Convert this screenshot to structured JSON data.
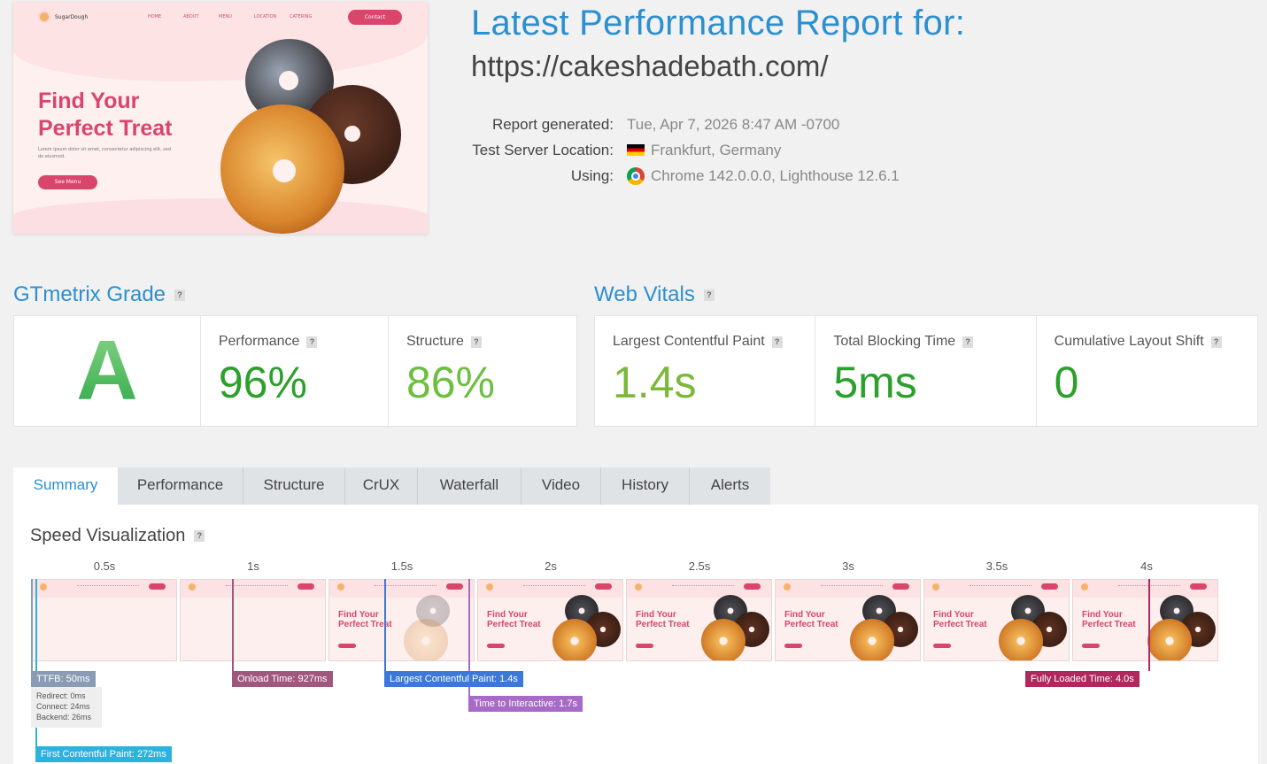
{
  "thumbnail": {
    "logo_text": "SugarDough",
    "nav": [
      "HOME",
      "ABOUT",
      "MENU",
      "LOCATION",
      "CATERING"
    ],
    "contact_label": "Contact",
    "hero_line1": "Find Your",
    "hero_line2": "Perfect Treat",
    "lorem": "Lorem ipsum dolor sit amet, consectetur adipiscing elit, sed do eiusmod.",
    "cta_label": "See Menu"
  },
  "header": {
    "title": "Latest Performance Report for:",
    "url": "https://cakeshadebath.com/"
  },
  "meta": {
    "generated_label": "Report generated:",
    "generated_value": "Tue, Apr 7, 2026 8:47 AM -0700",
    "location_label": "Test Server Location:",
    "location_value": "Frankfurt, Germany",
    "using_label": "Using:",
    "using_value": "Chrome 142.0.0.0, Lighthouse 12.6.1"
  },
  "gtmetrix": {
    "title": "GTmetrix Grade",
    "grade": "A",
    "performance_label": "Performance",
    "performance_value": "96%",
    "structure_label": "Structure",
    "structure_value": "86%"
  },
  "web_vitals": {
    "title": "Web Vitals",
    "lcp_label": "Largest Contentful Paint",
    "lcp_value": "1.4s",
    "tbt_label": "Total Blocking Time",
    "tbt_value": "5ms",
    "cls_label": "Cumulative Layout Shift",
    "cls_value": "0"
  },
  "tabs": [
    "Summary",
    "Performance",
    "Structure",
    "CrUX",
    "Waterfall",
    "Video",
    "History",
    "Alerts"
  ],
  "active_tab": "Summary",
  "speed_viz": {
    "title": "Speed Visualization",
    "ticks": [
      "0.5s",
      "1s",
      "1.5s",
      "2s",
      "2.5s",
      "3s",
      "3.5s",
      "4s"
    ],
    "frame_text_line1": "Find Your",
    "frame_text_line2": "Perfect Treat",
    "markers": {
      "ttfb": "TTFB: 50ms",
      "onload": "Onload Time: 927ms",
      "lcp": "Largest Contentful Paint: 1.4s",
      "tti": "Time to Interactive: 1.7s",
      "fully_loaded": "Fully Loaded Time: 4.0s",
      "fcp": "First Contentful Paint: 272ms"
    },
    "ttfb_details": {
      "redirect": "Redirect: 0ms",
      "connect": "Connect: 24ms",
      "backend": "Backend: 26ms"
    }
  },
  "colors": {
    "accent": "#2b8fd0",
    "grade_green": "#3aad4b",
    "perf_green": "#2ca02c",
    "struct_green": "#6cbf3f",
    "lcp_green": "#7cb83a",
    "ttfb": "#8c9bb5",
    "onload": "#a0577e",
    "lcp_marker": "#3b78d8",
    "tti": "#a76bc7",
    "fully_loaded": "#b0295e",
    "fcp": "#2bb3e0"
  }
}
